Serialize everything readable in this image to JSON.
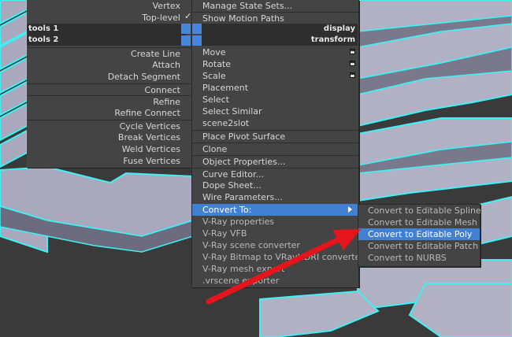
{
  "quad_left": {
    "items": [
      {
        "label": "Vertex"
      },
      {
        "label": "Top-level",
        "checked": true
      },
      {
        "label": "Create Line"
      },
      {
        "label": "Attach"
      },
      {
        "label": "Detach Segment"
      },
      {
        "label": "Connect"
      },
      {
        "label": "Refine"
      },
      {
        "label": "Refine Connect"
      },
      {
        "label": "Cycle Vertices"
      },
      {
        "label": "Break Vertices"
      },
      {
        "label": "Weld Vertices"
      },
      {
        "label": "Fuse Vertices"
      }
    ],
    "check_glyph": "✓"
  },
  "headers": {
    "tools1": "tools 1",
    "tools2": "tools 2",
    "display": "display",
    "transform": "transform"
  },
  "quad_right": {
    "items": [
      {
        "label": "Manage State Sets..."
      },
      {
        "label": "Show Motion Paths"
      },
      {
        "label": "Move",
        "options_box": true
      },
      {
        "label": "Rotate",
        "options_box": true
      },
      {
        "label": "Scale",
        "options_box": true
      },
      {
        "label": "Placement"
      },
      {
        "label": "Select"
      },
      {
        "label": "Select Similar"
      },
      {
        "label": "scene2slot"
      },
      {
        "label": "Place Pivot Surface"
      },
      {
        "label": "Clone"
      },
      {
        "label": "Object Properties..."
      },
      {
        "label": "Curve Editor..."
      },
      {
        "label": "Dope Sheet..."
      },
      {
        "label": "Wire Parameters..."
      },
      {
        "label": "Convert To:",
        "highlighted": true,
        "submenu": true
      },
      {
        "label": "V-Ray properties"
      },
      {
        "label": "V-Ray VFB"
      },
      {
        "label": "V-Ray scene converter"
      },
      {
        "label": "V-Ray Bitmap to VRayHDRI converter"
      },
      {
        "label": "V-Ray mesh export"
      },
      {
        "label": ".vrscene exporter"
      }
    ]
  },
  "submenu": {
    "items": [
      {
        "label": "Convert to Editable Spline"
      },
      {
        "label": "Convert to Editable Mesh"
      },
      {
        "label": "Convert to Editable Poly",
        "highlighted": true
      },
      {
        "label": "Convert to Editable Patch"
      },
      {
        "label": "Convert to NURBS"
      }
    ]
  },
  "colors": {
    "highlight": "#4280d4",
    "menu_bg": "#444444",
    "annotation_arrow": "#e8141c",
    "maze_outline": "#3ff0f4"
  },
  "icons": [
    "check-icon",
    "options-box-icon",
    "submenu-arrow-icon",
    "annotation-arrow-icon"
  ]
}
